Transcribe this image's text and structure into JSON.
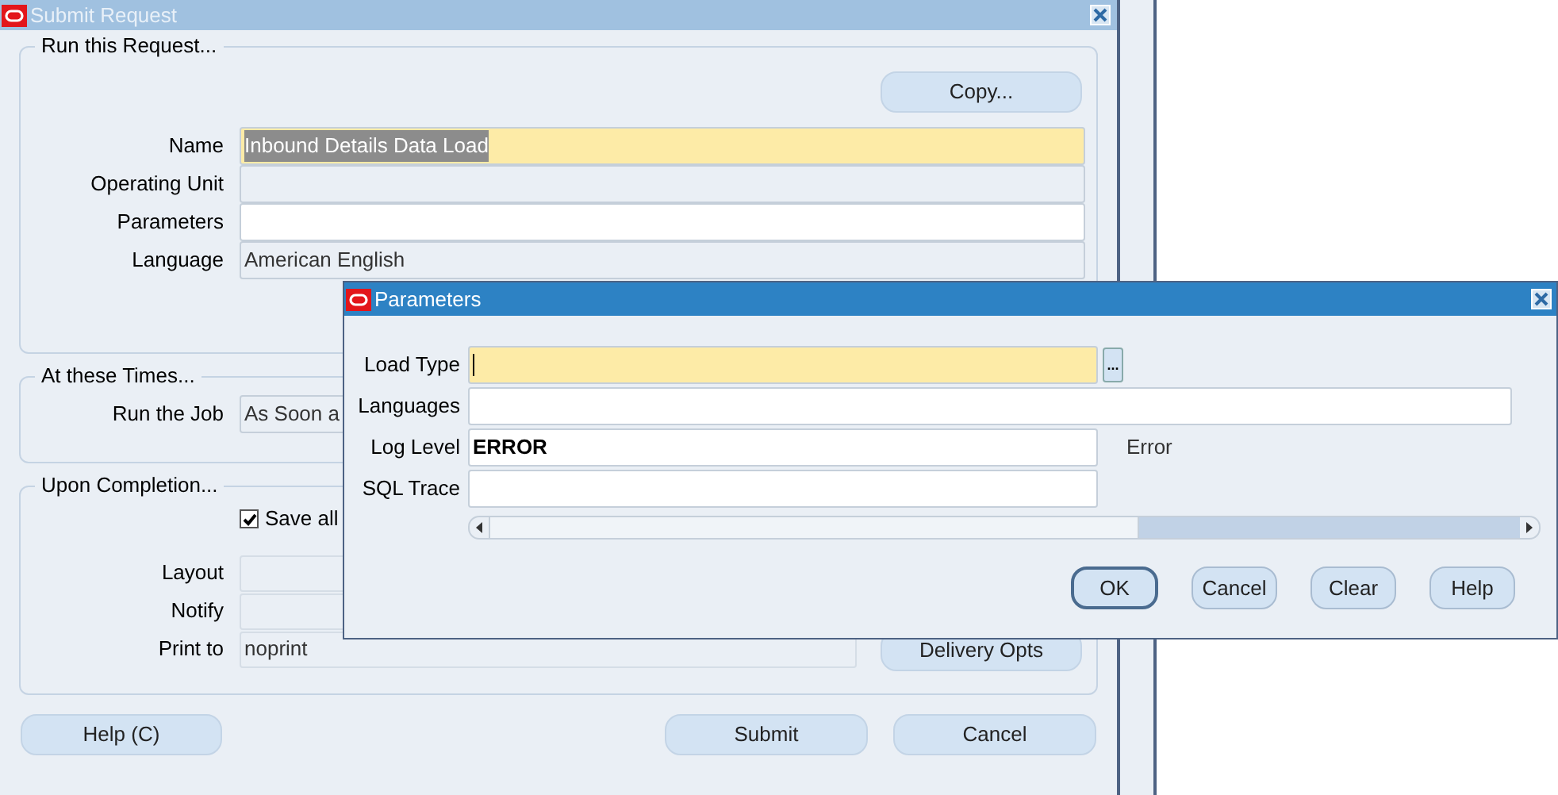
{
  "window": {
    "title": "Submit Request"
  },
  "request": {
    "legend": "Run this Request...",
    "copy_button": "Copy...",
    "fields": [
      {
        "label": "Name",
        "value": "Inbound Details Data Load",
        "kind": "selected"
      },
      {
        "label": "Operating Unit",
        "kind": "readonly"
      },
      {
        "label": "Parameters",
        "kind": "input"
      },
      {
        "label": "Language",
        "value": "American English",
        "kind": "readonly"
      }
    ]
  },
  "times": {
    "legend": "At these Times...",
    "label": "Run the Job",
    "value": "As Soon a"
  },
  "completion": {
    "legend": "Upon Completion...",
    "save_checkbox": {
      "label": "Save all",
      "checked": true
    },
    "fields": [
      {
        "label": "Layout"
      },
      {
        "label": "Notify"
      },
      {
        "label": "Print to",
        "value": "noprint"
      }
    ],
    "delivery_button": "Delivery Opts"
  },
  "buttons": [
    "Help (C)",
    "Submit",
    "Cancel"
  ],
  "dialog": {
    "title": "Parameters",
    "fields": [
      {
        "label": "Load Type",
        "kind": "required",
        "lov": "..."
      },
      {
        "label": "Languages",
        "kind": "wide"
      },
      {
        "label": "Log Level",
        "value": "ERROR",
        "kind": "input",
        "description": "Error"
      },
      {
        "label": "SQL Trace",
        "kind": "input"
      }
    ],
    "buttons": [
      {
        "label": "OK",
        "selected": true
      },
      {
        "label": "Cancel",
        "selected": false
      },
      {
        "label": "Clear",
        "selected": false
      },
      {
        "label": "Help",
        "selected": false
      }
    ]
  }
}
